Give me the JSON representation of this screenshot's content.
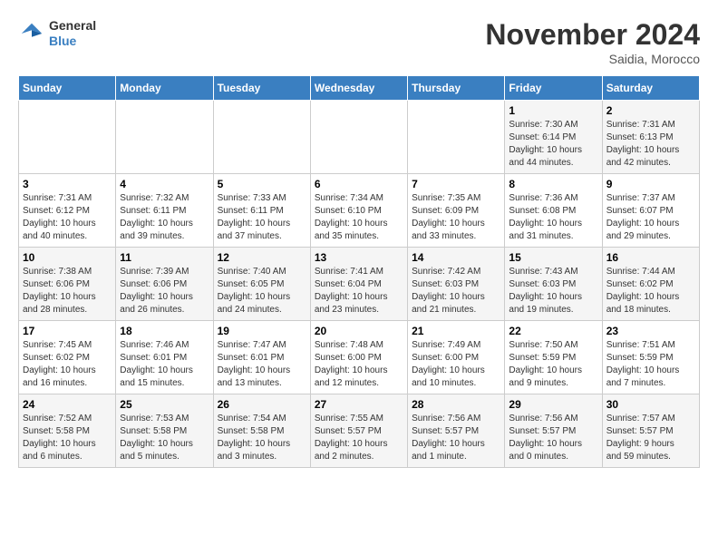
{
  "header": {
    "logo": {
      "general": "General",
      "blue": "Blue"
    },
    "title": "November 2024",
    "location": "Saidia, Morocco"
  },
  "calendar": {
    "weekdays": [
      "Sunday",
      "Monday",
      "Tuesday",
      "Wednesday",
      "Thursday",
      "Friday",
      "Saturday"
    ],
    "weeks": [
      [
        {
          "day": "",
          "info": ""
        },
        {
          "day": "",
          "info": ""
        },
        {
          "day": "",
          "info": ""
        },
        {
          "day": "",
          "info": ""
        },
        {
          "day": "",
          "info": ""
        },
        {
          "day": "1",
          "info": "Sunrise: 7:30 AM\nSunset: 6:14 PM\nDaylight: 10 hours\nand 44 minutes."
        },
        {
          "day": "2",
          "info": "Sunrise: 7:31 AM\nSunset: 6:13 PM\nDaylight: 10 hours\nand 42 minutes."
        }
      ],
      [
        {
          "day": "3",
          "info": "Sunrise: 7:31 AM\nSunset: 6:12 PM\nDaylight: 10 hours\nand 40 minutes."
        },
        {
          "day": "4",
          "info": "Sunrise: 7:32 AM\nSunset: 6:11 PM\nDaylight: 10 hours\nand 39 minutes."
        },
        {
          "day": "5",
          "info": "Sunrise: 7:33 AM\nSunset: 6:11 PM\nDaylight: 10 hours\nand 37 minutes."
        },
        {
          "day": "6",
          "info": "Sunrise: 7:34 AM\nSunset: 6:10 PM\nDaylight: 10 hours\nand 35 minutes."
        },
        {
          "day": "7",
          "info": "Sunrise: 7:35 AM\nSunset: 6:09 PM\nDaylight: 10 hours\nand 33 minutes."
        },
        {
          "day": "8",
          "info": "Sunrise: 7:36 AM\nSunset: 6:08 PM\nDaylight: 10 hours\nand 31 minutes."
        },
        {
          "day": "9",
          "info": "Sunrise: 7:37 AM\nSunset: 6:07 PM\nDaylight: 10 hours\nand 29 minutes."
        }
      ],
      [
        {
          "day": "10",
          "info": "Sunrise: 7:38 AM\nSunset: 6:06 PM\nDaylight: 10 hours\nand 28 minutes."
        },
        {
          "day": "11",
          "info": "Sunrise: 7:39 AM\nSunset: 6:06 PM\nDaylight: 10 hours\nand 26 minutes."
        },
        {
          "day": "12",
          "info": "Sunrise: 7:40 AM\nSunset: 6:05 PM\nDaylight: 10 hours\nand 24 minutes."
        },
        {
          "day": "13",
          "info": "Sunrise: 7:41 AM\nSunset: 6:04 PM\nDaylight: 10 hours\nand 23 minutes."
        },
        {
          "day": "14",
          "info": "Sunrise: 7:42 AM\nSunset: 6:03 PM\nDaylight: 10 hours\nand 21 minutes."
        },
        {
          "day": "15",
          "info": "Sunrise: 7:43 AM\nSunset: 6:03 PM\nDaylight: 10 hours\nand 19 minutes."
        },
        {
          "day": "16",
          "info": "Sunrise: 7:44 AM\nSunset: 6:02 PM\nDaylight: 10 hours\nand 18 minutes."
        }
      ],
      [
        {
          "day": "17",
          "info": "Sunrise: 7:45 AM\nSunset: 6:02 PM\nDaylight: 10 hours\nand 16 minutes."
        },
        {
          "day": "18",
          "info": "Sunrise: 7:46 AM\nSunset: 6:01 PM\nDaylight: 10 hours\nand 15 minutes."
        },
        {
          "day": "19",
          "info": "Sunrise: 7:47 AM\nSunset: 6:01 PM\nDaylight: 10 hours\nand 13 minutes."
        },
        {
          "day": "20",
          "info": "Sunrise: 7:48 AM\nSunset: 6:00 PM\nDaylight: 10 hours\nand 12 minutes."
        },
        {
          "day": "21",
          "info": "Sunrise: 7:49 AM\nSunset: 6:00 PM\nDaylight: 10 hours\nand 10 minutes."
        },
        {
          "day": "22",
          "info": "Sunrise: 7:50 AM\nSunset: 5:59 PM\nDaylight: 10 hours\nand 9 minutes."
        },
        {
          "day": "23",
          "info": "Sunrise: 7:51 AM\nSunset: 5:59 PM\nDaylight: 10 hours\nand 7 minutes."
        }
      ],
      [
        {
          "day": "24",
          "info": "Sunrise: 7:52 AM\nSunset: 5:58 PM\nDaylight: 10 hours\nand 6 minutes."
        },
        {
          "day": "25",
          "info": "Sunrise: 7:53 AM\nSunset: 5:58 PM\nDaylight: 10 hours\nand 5 minutes."
        },
        {
          "day": "26",
          "info": "Sunrise: 7:54 AM\nSunset: 5:58 PM\nDaylight: 10 hours\nand 3 minutes."
        },
        {
          "day": "27",
          "info": "Sunrise: 7:55 AM\nSunset: 5:57 PM\nDaylight: 10 hours\nand 2 minutes."
        },
        {
          "day": "28",
          "info": "Sunrise: 7:56 AM\nSunset: 5:57 PM\nDaylight: 10 hours\nand 1 minute."
        },
        {
          "day": "29",
          "info": "Sunrise: 7:56 AM\nSunset: 5:57 PM\nDaylight: 10 hours\nand 0 minutes."
        },
        {
          "day": "30",
          "info": "Sunrise: 7:57 AM\nSunset: 5:57 PM\nDaylight: 9 hours\nand 59 minutes."
        }
      ]
    ]
  }
}
